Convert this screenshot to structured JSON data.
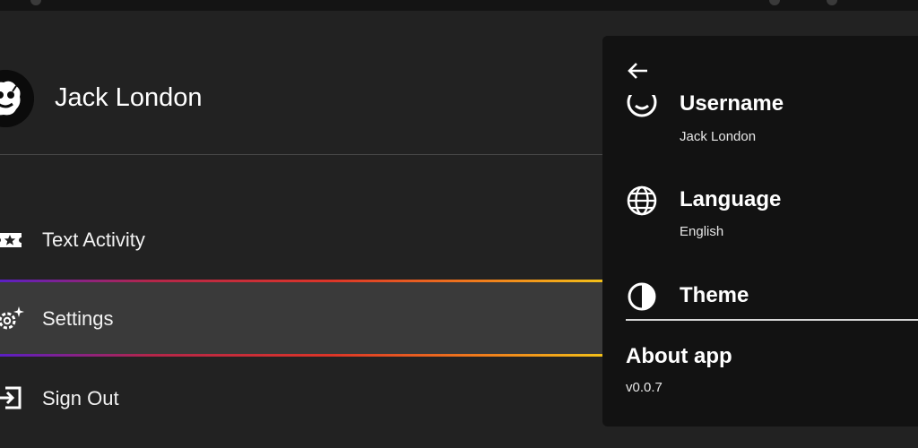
{
  "profile": {
    "name": "Jack London"
  },
  "menu": {
    "items": [
      {
        "label": "Text Activity",
        "icon": "ticket-star-icon"
      },
      {
        "label": "Settings",
        "icon": "gear-sparkle-icon",
        "selected": true
      },
      {
        "label": "Sign Out",
        "icon": "sign-out-icon"
      }
    ]
  },
  "settings_panel": {
    "username": {
      "title": "Username",
      "value": "Jack London",
      "icon": "face-icon"
    },
    "language": {
      "title": "Language",
      "value": "English",
      "icon": "globe-icon"
    },
    "theme": {
      "title": "Theme",
      "icon": "contrast-icon"
    },
    "about": {
      "title": "About app",
      "version": "v0.0.7"
    }
  },
  "colors": {
    "background": "#222222",
    "panel": "#121212",
    "selected": "#3a3a3a",
    "gradient": [
      "#5b1fc4",
      "#dc3528",
      "#f3c019"
    ]
  }
}
